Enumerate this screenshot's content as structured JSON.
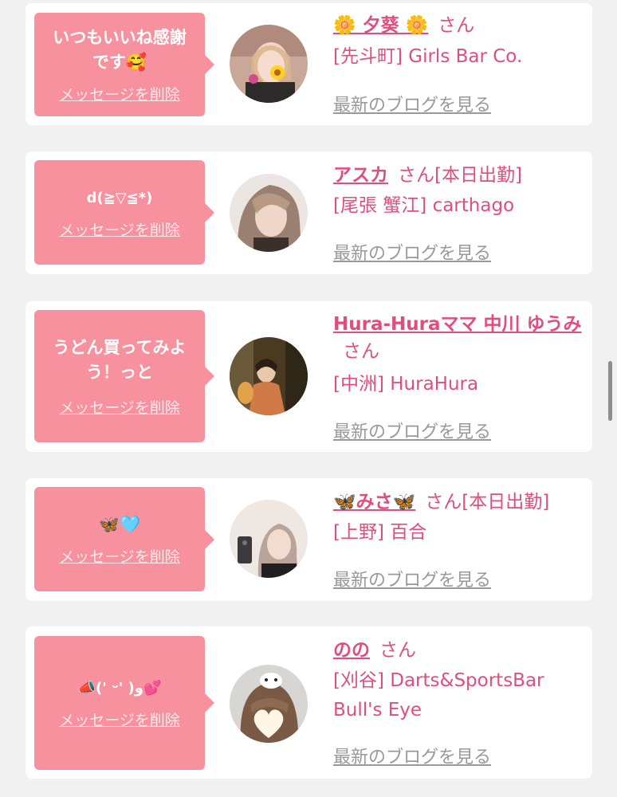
{
  "items": [
    {
      "message": "いつもいいね感謝です🥰",
      "delete_label": "メッセージを削除",
      "name": "🌼 夕葵 🌼",
      "honorific": "さん",
      "status": "",
      "shop": "[先斗町] Girls Bar Co.",
      "blog_label": "最新のブログを見る"
    },
    {
      "message": "d(≧▽≦*)",
      "delete_label": "メッセージを削除",
      "name": "アスカ",
      "honorific": "さん",
      "status": "[本日出勤]",
      "shop": "[尾張 蟹江] carthago",
      "blog_label": "最新のブログを見る"
    },
    {
      "message": "うどん買ってみよう！っと",
      "delete_label": "メッセージを削除",
      "name": "Hura-Huraママ 中川 ゆうみ",
      "honorific": "さん",
      "status": "",
      "shop": "[中洲] HuraHura",
      "blog_label": "最新のブログを見る"
    },
    {
      "message": "🦋🩵",
      "delete_label": "メッセージを削除",
      "name": "🦋みさ🦋",
      "honorific": "さん",
      "status": "[本日出勤]",
      "shop": "[上野] 百合",
      "blog_label": "最新のブログを見る"
    },
    {
      "message": "📣(' ᵕ' )و💕",
      "delete_label": "メッセージを削除",
      "name": "のの",
      "honorific": "さん",
      "status": "",
      "shop": "[刈谷] Darts&SportsBar Bull's Eye",
      "blog_label": "最新のブログを見る"
    }
  ],
  "colors": {
    "bubble": "#f8919e",
    "accent": "#e04e7e",
    "link_gray": "#999999",
    "background": "#f1f1f1"
  }
}
